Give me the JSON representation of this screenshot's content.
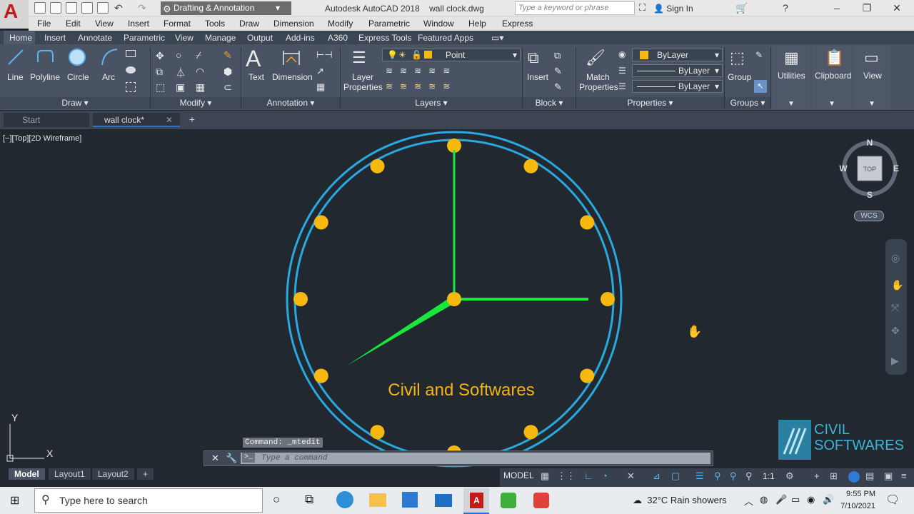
{
  "title_bar": {
    "workspace": "Drafting & Annotation",
    "app_title": "Autodesk AutoCAD 2018",
    "file_name": "wall clock.dwg",
    "search_placeholder": "Type a keyword or phrase",
    "sign_in": "Sign In"
  },
  "menu": [
    "File",
    "Edit",
    "View",
    "Insert",
    "Format",
    "Tools",
    "Draw",
    "Dimension",
    "Modify",
    "Parametric",
    "Window",
    "Help",
    "Express"
  ],
  "ribbon_tabs": [
    "Home",
    "Insert",
    "Annotate",
    "Parametric",
    "View",
    "Manage",
    "Output",
    "Add-ins",
    "A360",
    "Express Tools",
    "Featured Apps"
  ],
  "ribbon": {
    "draw": {
      "line": "Line",
      "polyline": "Polyline",
      "circle": "Circle",
      "arc": "Arc",
      "panel": "Draw"
    },
    "modify": {
      "panel": "Modify"
    },
    "annotation": {
      "text": "Text",
      "dimension": "Dimension",
      "panel": "Annotation"
    },
    "layers": {
      "layer_properties_1": "Layer",
      "layer_properties_2": "Properties",
      "current_layer": "Point",
      "panel": "Layers"
    },
    "block": {
      "insert": "Insert",
      "panel": "Block"
    },
    "properties": {
      "match_1": "Match",
      "match_2": "Properties",
      "color": "ByLayer",
      "linetype": "ByLayer",
      "lineweight": "ByLayer",
      "panel": "Properties"
    },
    "groups": {
      "group": "Group",
      "panel": "Groups"
    },
    "utilities": "Utilities",
    "clipboard": "Clipboard",
    "view": "View"
  },
  "doc_tabs": {
    "start": "Start",
    "active": "wall clock*"
  },
  "viewport": {
    "controls": "[−][Top][2D Wireframe]",
    "clock_text": "Civil and Softwares",
    "viewcube": {
      "n": "N",
      "s": "S",
      "e": "E",
      "w": "W",
      "top": "TOP",
      "wcs": "WCS"
    },
    "ucs": {
      "x": "X",
      "y": "Y"
    }
  },
  "colors": {
    "ring": "#29a9e0",
    "dots": "#f7b90f",
    "hands": "#19e83b",
    "text": "#f2b314",
    "canvas": "#212830",
    "ribbon": "#4a5363"
  },
  "clock": {
    "hour_hand_angle_deg": 240,
    "minute_hand_angle_deg": 0,
    "second_hand_angle_deg": 90,
    "markers": 12
  },
  "command": {
    "history": "Command: _mtedit",
    "placeholder": "Type a command"
  },
  "layout_tabs": [
    "Model",
    "Layout1",
    "Layout2"
  ],
  "status": {
    "model": "MODEL",
    "scale": "1:1"
  },
  "watermark": {
    "line1": "CIVIL",
    "line2": "SOFTWARES"
  },
  "taskbar": {
    "search": "Type here to search",
    "weather": "32°C  Rain showers",
    "time": "9:55 PM",
    "date": "7/10/2021"
  }
}
